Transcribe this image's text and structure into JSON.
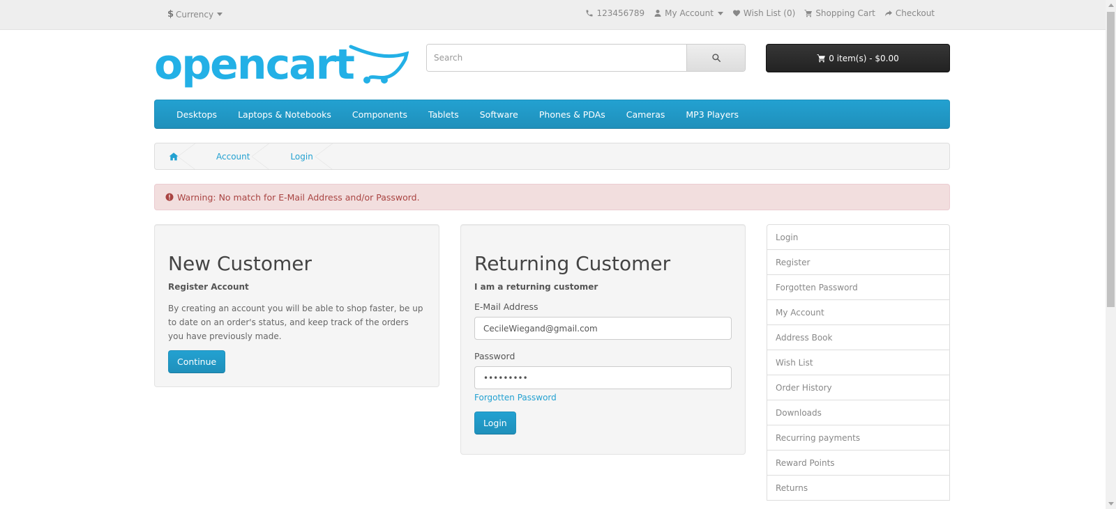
{
  "colors": {
    "accent": "#23a1d1",
    "alert_bg": "#f2dede",
    "alert_text": "#a94442",
    "cart_bg": "#222222"
  },
  "topbar": {
    "currency_symbol": "$",
    "currency_label": "Currency",
    "phone": "123456789",
    "my_account": "My Account",
    "wish_list": "Wish List (0)",
    "shopping_cart": "Shopping Cart",
    "checkout": "Checkout"
  },
  "header": {
    "logo_text": "opencart",
    "search_placeholder": "Search",
    "cart_label": "0 item(s) - $0.00"
  },
  "menu": [
    "Desktops",
    "Laptops & Notebooks",
    "Components",
    "Tablets",
    "Software",
    "Phones & PDAs",
    "Cameras",
    "MP3 Players"
  ],
  "breadcrumb": [
    "Account",
    "Login"
  ],
  "alert": "Warning: No match for E-Mail Address and/or Password.",
  "new_customer": {
    "title": "New Customer",
    "subtitle": "Register Account",
    "body": "By creating an account you will be able to shop faster, be up to date on an order's status, and keep track of the orders you have previously made.",
    "button": "Continue"
  },
  "returning_customer": {
    "title": "Returning Customer",
    "subtitle": "I am a returning customer",
    "email_label": "E-Mail Address",
    "email_value": "CecileWiegand@gmail.com",
    "password_label": "Password",
    "password_value": "•••••••••",
    "forgot": "Forgotten Password",
    "button": "Login"
  },
  "sidebar": [
    "Login",
    "Register",
    "Forgotten Password",
    "My Account",
    "Address Book",
    "Wish List",
    "Order History",
    "Downloads",
    "Recurring payments",
    "Reward Points",
    "Returns"
  ]
}
